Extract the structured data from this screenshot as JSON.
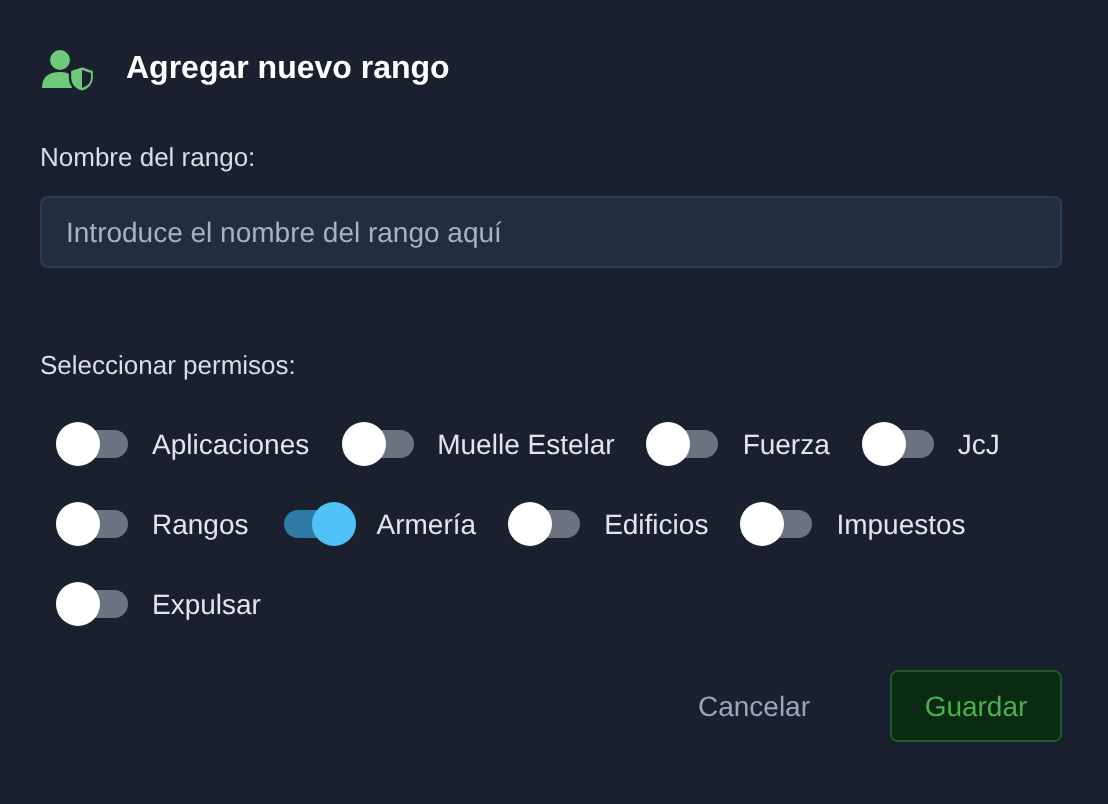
{
  "dialog": {
    "title": "Agregar nuevo rango"
  },
  "name_field": {
    "label": "Nombre del rango:",
    "placeholder": "Introduce el nombre del rango aquí"
  },
  "permissions": {
    "label": "Seleccionar permisos:",
    "items": [
      {
        "label": "Aplicaciones",
        "on": false
      },
      {
        "label": "Muelle Estelar",
        "on": false
      },
      {
        "label": "Fuerza",
        "on": false
      },
      {
        "label": "JcJ",
        "on": false
      },
      {
        "label": "Rangos",
        "on": false
      },
      {
        "label": "Armería",
        "on": true
      },
      {
        "label": "Edificios",
        "on": false
      },
      {
        "label": "Impuestos",
        "on": false
      },
      {
        "label": "Expulsar",
        "on": false
      }
    ]
  },
  "buttons": {
    "cancel": "Cancelar",
    "save": "Guardar"
  }
}
